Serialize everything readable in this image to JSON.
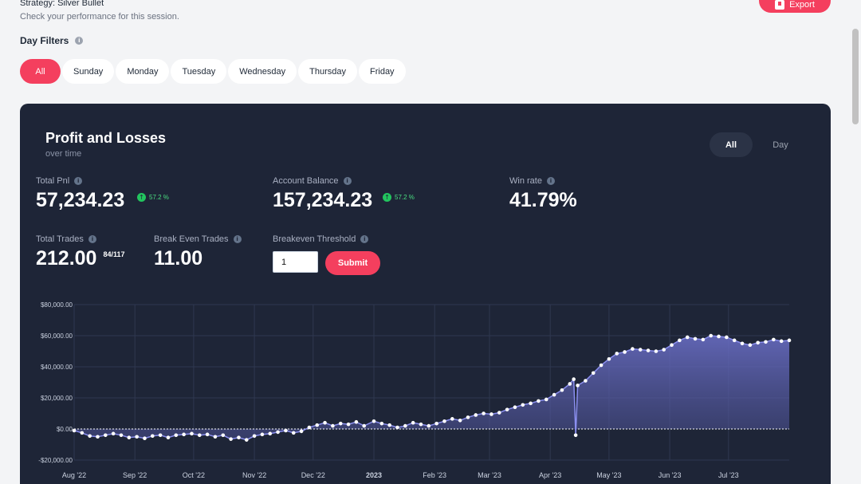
{
  "header": {
    "strategy": "Strategy: Silver Bullet",
    "subtitle": "Check your performance for this session.",
    "export_label": "Export"
  },
  "day_filters": {
    "label": "Day Filters",
    "tabs": [
      "All",
      "Sunday",
      "Monday",
      "Tuesday",
      "Wednesday",
      "Thursday",
      "Friday"
    ],
    "active": "All"
  },
  "panel": {
    "title": "Profit and Losses",
    "subtitle": "over time",
    "range_toggle": [
      "All",
      "Day"
    ],
    "range_active": "All"
  },
  "stats": {
    "total_pnl": {
      "label": "Total Pnl",
      "value": "57,234.23",
      "change": "57.2 %"
    },
    "account_balance": {
      "label": "Account Balance",
      "value": "157,234.23",
      "change": "57.2 %"
    },
    "win_rate": {
      "label": "Win rate",
      "value": "41.79%"
    },
    "total_trades": {
      "label": "Total Trades",
      "value": "212.00",
      "detail": "84/117"
    },
    "break_even_trades": {
      "label": "Break Even Trades",
      "value": "11.00"
    },
    "breakeven_threshold": {
      "label": "Breakeven Threshold",
      "value": "1",
      "submit_label": "Submit"
    }
  },
  "colors": {
    "accent": "#f43f5e",
    "panel_bg": "#1e2537",
    "line": "#8b8ff0",
    "positive": "#22c55e"
  },
  "chart_data": {
    "type": "area",
    "title": "",
    "xlabel": "",
    "ylabel": "",
    "ylim": [
      -20000,
      80000
    ],
    "y_ticks": [
      "$80,000.00",
      "$60,000.00",
      "$40,000.00",
      "$20,000.00",
      "$0.00",
      "-$20,000.00"
    ],
    "y_tick_values": [
      80000,
      60000,
      40000,
      20000,
      0,
      -20000
    ],
    "x_ticks": [
      "Aug '22",
      "Sep '22",
      "Oct '22",
      "Nov '22",
      "Dec '22",
      "2023",
      "Feb '23",
      "Mar '23",
      "Apr '23",
      "May '23",
      "Jun '23",
      "Jul '23"
    ],
    "x_tick_dates": [
      "2022-08-01",
      "2022-09-01",
      "2022-10-01",
      "2022-11-01",
      "2022-12-01",
      "2023-01-01",
      "2023-02-01",
      "2023-03-01",
      "2023-04-01",
      "2023-05-01",
      "2023-06-01",
      "2023-07-01"
    ],
    "x_range": [
      "2022-08-01",
      "2023-08-01"
    ],
    "grid": true,
    "series": [
      {
        "x": [
          "2022-08-01",
          "2022-08-05",
          "2022-08-09",
          "2022-08-13",
          "2022-08-17",
          "2022-08-21",
          "2022-08-25",
          "2022-08-29",
          "2022-09-02",
          "2022-09-06",
          "2022-09-10",
          "2022-09-14",
          "2022-09-18",
          "2022-09-22",
          "2022-09-26",
          "2022-09-30",
          "2022-10-04",
          "2022-10-08",
          "2022-10-12",
          "2022-10-16",
          "2022-10-20",
          "2022-10-24",
          "2022-10-28",
          "2022-11-01",
          "2022-11-05",
          "2022-11-09",
          "2022-11-13",
          "2022-11-17",
          "2022-11-21",
          "2022-11-25",
          "2022-11-29",
          "2022-12-03",
          "2022-12-07",
          "2022-12-11",
          "2022-12-15",
          "2022-12-19",
          "2022-12-23",
          "2022-12-27",
          "2023-01-01",
          "2023-01-05",
          "2023-01-09",
          "2023-01-13",
          "2023-01-17",
          "2023-01-21",
          "2023-01-25",
          "2023-01-29",
          "2023-02-02",
          "2023-02-06",
          "2023-02-10",
          "2023-02-14",
          "2023-02-18",
          "2023-02-22",
          "2023-02-26",
          "2023-03-02",
          "2023-03-06",
          "2023-03-10",
          "2023-03-14",
          "2023-03-18",
          "2023-03-22",
          "2023-03-26",
          "2023-03-30",
          "2023-04-03",
          "2023-04-07",
          "2023-04-11",
          "2023-04-13",
          "2023-04-14",
          "2023-04-15",
          "2023-04-19",
          "2023-04-23",
          "2023-04-27",
          "2023-05-01",
          "2023-05-05",
          "2023-05-09",
          "2023-05-13",
          "2023-05-17",
          "2023-05-21",
          "2023-05-25",
          "2023-05-29",
          "2023-06-02",
          "2023-06-06",
          "2023-06-10",
          "2023-06-14",
          "2023-06-18",
          "2023-06-22",
          "2023-06-26",
          "2023-06-30",
          "2023-07-04",
          "2023-07-08",
          "2023-07-12",
          "2023-07-16",
          "2023-07-20",
          "2023-07-24",
          "2023-07-28",
          "2023-08-01"
        ],
        "y": [
          -1000,
          -2500,
          -4500,
          -5000,
          -4000,
          -3000,
          -4000,
          -5500,
          -5000,
          -6000,
          -4500,
          -4000,
          -5500,
          -4000,
          -3500,
          -3000,
          -4000,
          -3500,
          -5000,
          -4000,
          -6500,
          -5500,
          -7000,
          -4500,
          -3500,
          -3000,
          -2000,
          -1000,
          -2500,
          -1500,
          1000,
          2500,
          4000,
          2000,
          3500,
          3000,
          4500,
          2000,
          5000,
          3500,
          2500,
          1000,
          2000,
          4000,
          3000,
          2000,
          3500,
          5000,
          6500,
          5500,
          7500,
          9000,
          10000,
          9500,
          10500,
          12500,
          14000,
          15500,
          16500,
          18000,
          19000,
          22000,
          25000,
          29000,
          32000,
          -4000,
          28000,
          31000,
          36000,
          41000,
          45000,
          48500,
          49500,
          51500,
          51000,
          50500,
          50000,
          51000,
          54000,
          57000,
          59000,
          58000,
          57500,
          60000,
          59500,
          59000,
          57000,
          55000,
          54000,
          55500,
          56000,
          57500,
          56500,
          57000
        ]
      }
    ]
  }
}
